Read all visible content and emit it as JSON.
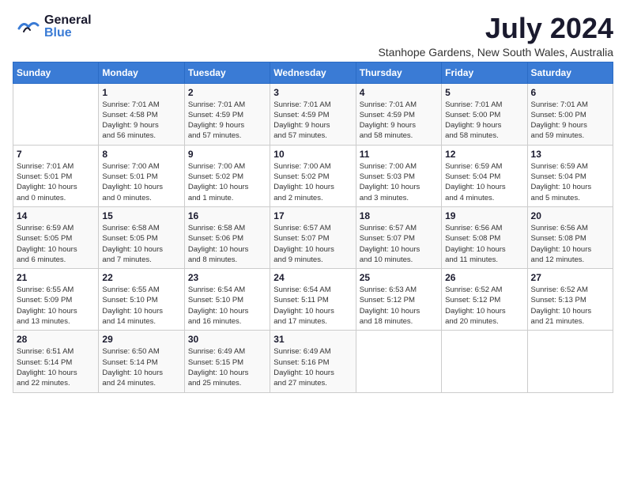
{
  "header": {
    "logo_general": "General",
    "logo_blue": "Blue",
    "month_year": "July 2024",
    "location": "Stanhope Gardens, New South Wales, Australia"
  },
  "days_of_week": [
    "Sunday",
    "Monday",
    "Tuesday",
    "Wednesday",
    "Thursday",
    "Friday",
    "Saturday"
  ],
  "weeks": [
    [
      {
        "day": "",
        "info": ""
      },
      {
        "day": "1",
        "info": "Sunrise: 7:01 AM\nSunset: 4:58 PM\nDaylight: 9 hours\nand 56 minutes."
      },
      {
        "day": "2",
        "info": "Sunrise: 7:01 AM\nSunset: 4:59 PM\nDaylight: 9 hours\nand 57 minutes."
      },
      {
        "day": "3",
        "info": "Sunrise: 7:01 AM\nSunset: 4:59 PM\nDaylight: 9 hours\nand 57 minutes."
      },
      {
        "day": "4",
        "info": "Sunrise: 7:01 AM\nSunset: 4:59 PM\nDaylight: 9 hours\nand 58 minutes."
      },
      {
        "day": "5",
        "info": "Sunrise: 7:01 AM\nSunset: 5:00 PM\nDaylight: 9 hours\nand 58 minutes."
      },
      {
        "day": "6",
        "info": "Sunrise: 7:01 AM\nSunset: 5:00 PM\nDaylight: 9 hours\nand 59 minutes."
      }
    ],
    [
      {
        "day": "7",
        "info": "Sunrise: 7:01 AM\nSunset: 5:01 PM\nDaylight: 10 hours\nand 0 minutes."
      },
      {
        "day": "8",
        "info": "Sunrise: 7:00 AM\nSunset: 5:01 PM\nDaylight: 10 hours\nand 0 minutes."
      },
      {
        "day": "9",
        "info": "Sunrise: 7:00 AM\nSunset: 5:02 PM\nDaylight: 10 hours\nand 1 minute."
      },
      {
        "day": "10",
        "info": "Sunrise: 7:00 AM\nSunset: 5:02 PM\nDaylight: 10 hours\nand 2 minutes."
      },
      {
        "day": "11",
        "info": "Sunrise: 7:00 AM\nSunset: 5:03 PM\nDaylight: 10 hours\nand 3 minutes."
      },
      {
        "day": "12",
        "info": "Sunrise: 6:59 AM\nSunset: 5:04 PM\nDaylight: 10 hours\nand 4 minutes."
      },
      {
        "day": "13",
        "info": "Sunrise: 6:59 AM\nSunset: 5:04 PM\nDaylight: 10 hours\nand 5 minutes."
      }
    ],
    [
      {
        "day": "14",
        "info": "Sunrise: 6:59 AM\nSunset: 5:05 PM\nDaylight: 10 hours\nand 6 minutes."
      },
      {
        "day": "15",
        "info": "Sunrise: 6:58 AM\nSunset: 5:05 PM\nDaylight: 10 hours\nand 7 minutes."
      },
      {
        "day": "16",
        "info": "Sunrise: 6:58 AM\nSunset: 5:06 PM\nDaylight: 10 hours\nand 8 minutes."
      },
      {
        "day": "17",
        "info": "Sunrise: 6:57 AM\nSunset: 5:07 PM\nDaylight: 10 hours\nand 9 minutes."
      },
      {
        "day": "18",
        "info": "Sunrise: 6:57 AM\nSunset: 5:07 PM\nDaylight: 10 hours\nand 10 minutes."
      },
      {
        "day": "19",
        "info": "Sunrise: 6:56 AM\nSunset: 5:08 PM\nDaylight: 10 hours\nand 11 minutes."
      },
      {
        "day": "20",
        "info": "Sunrise: 6:56 AM\nSunset: 5:08 PM\nDaylight: 10 hours\nand 12 minutes."
      }
    ],
    [
      {
        "day": "21",
        "info": "Sunrise: 6:55 AM\nSunset: 5:09 PM\nDaylight: 10 hours\nand 13 minutes."
      },
      {
        "day": "22",
        "info": "Sunrise: 6:55 AM\nSunset: 5:10 PM\nDaylight: 10 hours\nand 14 minutes."
      },
      {
        "day": "23",
        "info": "Sunrise: 6:54 AM\nSunset: 5:10 PM\nDaylight: 10 hours\nand 16 minutes."
      },
      {
        "day": "24",
        "info": "Sunrise: 6:54 AM\nSunset: 5:11 PM\nDaylight: 10 hours\nand 17 minutes."
      },
      {
        "day": "25",
        "info": "Sunrise: 6:53 AM\nSunset: 5:12 PM\nDaylight: 10 hours\nand 18 minutes."
      },
      {
        "day": "26",
        "info": "Sunrise: 6:52 AM\nSunset: 5:12 PM\nDaylight: 10 hours\nand 20 minutes."
      },
      {
        "day": "27",
        "info": "Sunrise: 6:52 AM\nSunset: 5:13 PM\nDaylight: 10 hours\nand 21 minutes."
      }
    ],
    [
      {
        "day": "28",
        "info": "Sunrise: 6:51 AM\nSunset: 5:14 PM\nDaylight: 10 hours\nand 22 minutes."
      },
      {
        "day": "29",
        "info": "Sunrise: 6:50 AM\nSunset: 5:14 PM\nDaylight: 10 hours\nand 24 minutes."
      },
      {
        "day": "30",
        "info": "Sunrise: 6:49 AM\nSunset: 5:15 PM\nDaylight: 10 hours\nand 25 minutes."
      },
      {
        "day": "31",
        "info": "Sunrise: 6:49 AM\nSunset: 5:16 PM\nDaylight: 10 hours\nand 27 minutes."
      },
      {
        "day": "",
        "info": ""
      },
      {
        "day": "",
        "info": ""
      },
      {
        "day": "",
        "info": ""
      }
    ]
  ]
}
